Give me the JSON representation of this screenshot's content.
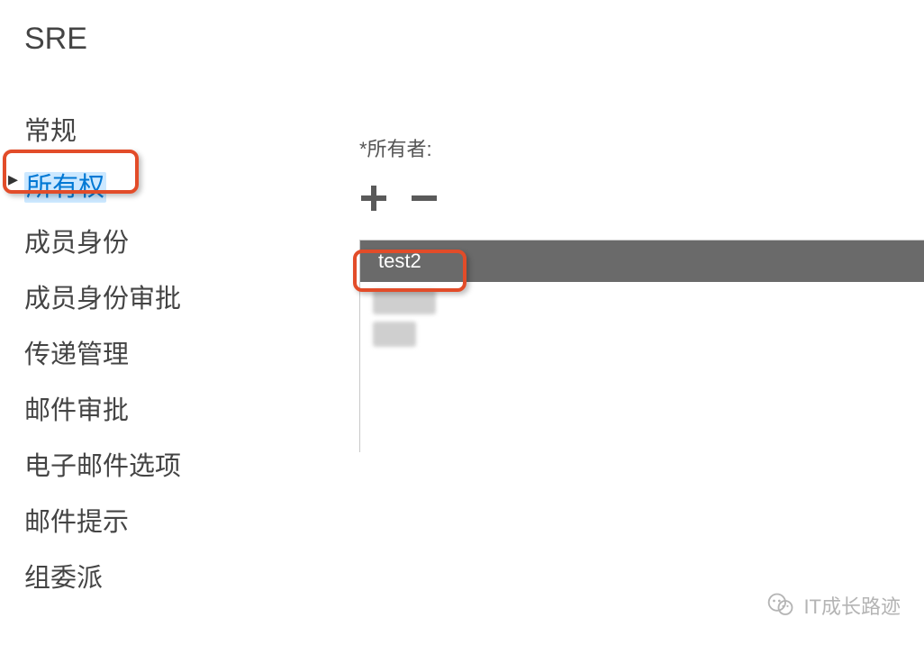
{
  "page_title": "SRE",
  "sidebar": {
    "items": [
      {
        "label": "常规"
      },
      {
        "label": "所有权"
      },
      {
        "label": "成员身份"
      },
      {
        "label": "成员身份审批"
      },
      {
        "label": "传递管理"
      },
      {
        "label": "邮件审批"
      },
      {
        "label": "电子邮件选项"
      },
      {
        "label": "邮件提示"
      },
      {
        "label": "组委派"
      }
    ],
    "selected_index": 1
  },
  "main": {
    "owner_field_label": "*所有者:",
    "owners": [
      {
        "name": "test2",
        "redacted": false
      },
      {
        "name": "",
        "redacted": true
      },
      {
        "name": "",
        "redacted": true
      }
    ],
    "selected_owner_index": 0
  },
  "icons": {
    "add": "plus-icon",
    "remove": "minus-icon"
  },
  "colors": {
    "accent": "#0078D4",
    "highlight_border": "#E24C29",
    "selected_row_bg": "#6a6a6a"
  },
  "watermark": {
    "text": "IT成长路迹"
  }
}
